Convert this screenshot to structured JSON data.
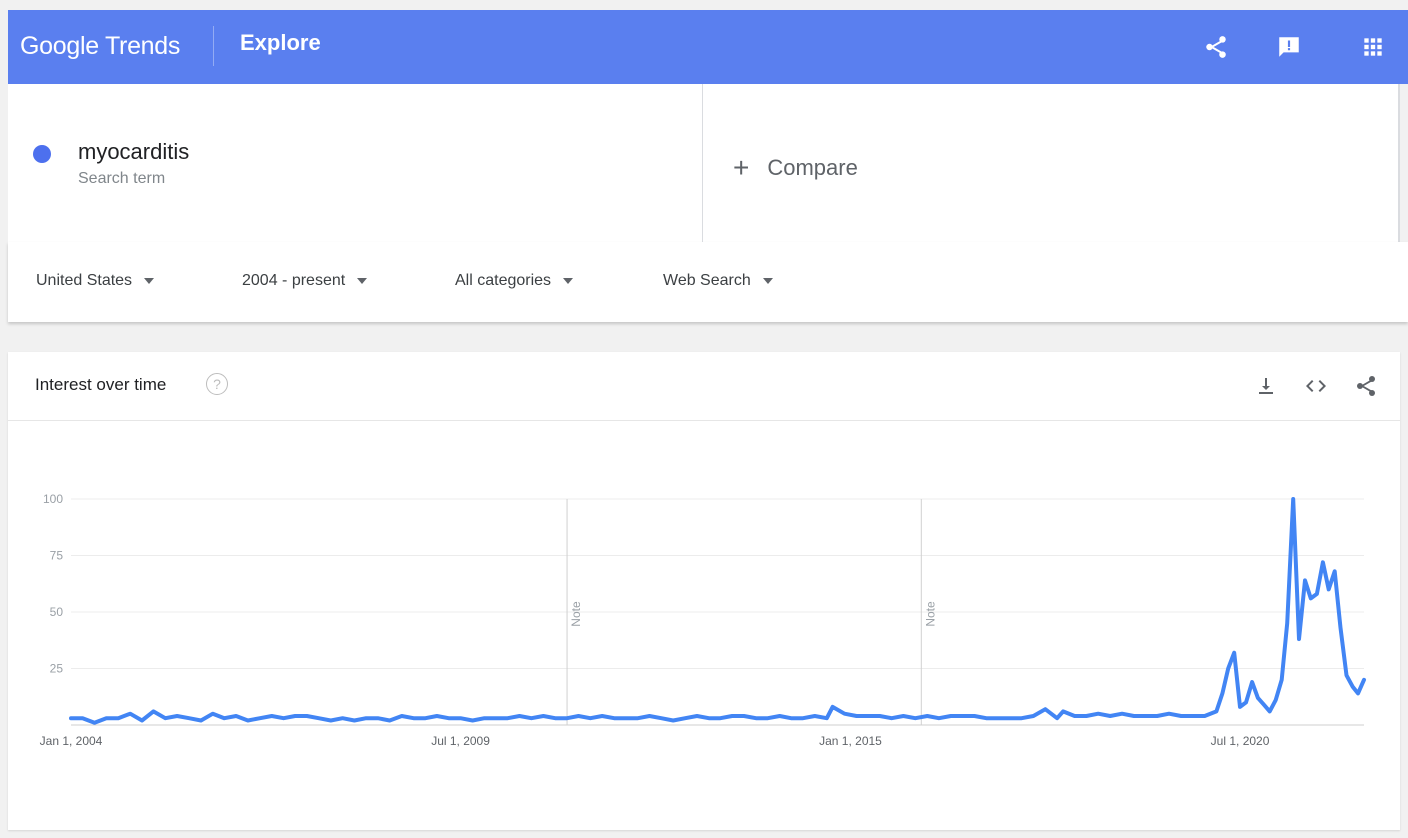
{
  "header": {
    "logo_text": "Google Trends",
    "section": "Explore",
    "icons": [
      "share-icon",
      "feedback-icon",
      "apps-grid-icon"
    ]
  },
  "search": {
    "term": "myocarditis",
    "term_type": "Search term",
    "term_color": "#4d70ee",
    "compare_label": "Compare"
  },
  "filters": {
    "region": "United States",
    "time_range": "2004 - present",
    "category": "All categories",
    "search_type": "Web Search"
  },
  "card": {
    "title": "Interest over time",
    "help_glyph": "?",
    "actions": [
      "download-icon",
      "embed-icon",
      "share-icon"
    ]
  },
  "chart_data": {
    "type": "line",
    "title": "",
    "xlabel": "",
    "ylabel": "",
    "ylim": [
      0,
      100
    ],
    "y_ticks": [
      25,
      50,
      75,
      100
    ],
    "x_ticks": [
      {
        "date": "2004-01-01",
        "label": "Jan 1, 2004"
      },
      {
        "date": "2009-07-01",
        "label": "Jul 1, 2009"
      },
      {
        "date": "2015-01-01",
        "label": "Jan 1, 2015"
      },
      {
        "date": "2020-07-01",
        "label": "Jul 1, 2020"
      }
    ],
    "xlim": [
      "2004-01-01",
      "2022-04-01"
    ],
    "grid": true,
    "line_color": "#4285f4",
    "notes": [
      {
        "date": "2011-01-01",
        "label": "Note"
      },
      {
        "date": "2016-01-01",
        "label": "Note"
      }
    ],
    "series": [
      {
        "name": "myocarditis",
        "points": [
          [
            "2004-01-01",
            3
          ],
          [
            "2004-03-01",
            3
          ],
          [
            "2004-05-01",
            1
          ],
          [
            "2004-07-01",
            3
          ],
          [
            "2004-09-01",
            3
          ],
          [
            "2004-11-01",
            5
          ],
          [
            "2005-01-01",
            2
          ],
          [
            "2005-03-01",
            6
          ],
          [
            "2005-05-01",
            3
          ],
          [
            "2005-07-01",
            4
          ],
          [
            "2005-09-01",
            3
          ],
          [
            "2005-11-01",
            2
          ],
          [
            "2006-01-01",
            5
          ],
          [
            "2006-03-01",
            3
          ],
          [
            "2006-05-01",
            4
          ],
          [
            "2006-07-01",
            2
          ],
          [
            "2006-09-01",
            3
          ],
          [
            "2006-11-01",
            4
          ],
          [
            "2007-01-01",
            3
          ],
          [
            "2007-03-01",
            4
          ],
          [
            "2007-05-01",
            4
          ],
          [
            "2007-07-01",
            3
          ],
          [
            "2007-09-01",
            2
          ],
          [
            "2007-11-01",
            3
          ],
          [
            "2008-01-01",
            2
          ],
          [
            "2008-03-01",
            3
          ],
          [
            "2008-05-01",
            3
          ],
          [
            "2008-07-01",
            2
          ],
          [
            "2008-09-01",
            4
          ],
          [
            "2008-11-01",
            3
          ],
          [
            "2009-01-01",
            3
          ],
          [
            "2009-03-01",
            4
          ],
          [
            "2009-05-01",
            3
          ],
          [
            "2009-07-01",
            3
          ],
          [
            "2009-09-01",
            2
          ],
          [
            "2009-11-01",
            3
          ],
          [
            "2010-01-01",
            3
          ],
          [
            "2010-03-01",
            3
          ],
          [
            "2010-05-01",
            4
          ],
          [
            "2010-07-01",
            3
          ],
          [
            "2010-09-01",
            4
          ],
          [
            "2010-11-01",
            3
          ],
          [
            "2011-01-01",
            3
          ],
          [
            "2011-03-01",
            4
          ],
          [
            "2011-05-01",
            3
          ],
          [
            "2011-07-01",
            4
          ],
          [
            "2011-09-01",
            3
          ],
          [
            "2011-11-01",
            3
          ],
          [
            "2012-01-01",
            3
          ],
          [
            "2012-03-01",
            4
          ],
          [
            "2012-05-01",
            3
          ],
          [
            "2012-07-01",
            2
          ],
          [
            "2012-09-01",
            3
          ],
          [
            "2012-11-01",
            4
          ],
          [
            "2013-01-01",
            3
          ],
          [
            "2013-03-01",
            3
          ],
          [
            "2013-05-01",
            4
          ],
          [
            "2013-07-01",
            4
          ],
          [
            "2013-09-01",
            3
          ],
          [
            "2013-11-01",
            3
          ],
          [
            "2014-01-01",
            4
          ],
          [
            "2014-03-01",
            3
          ],
          [
            "2014-05-01",
            3
          ],
          [
            "2014-07-01",
            4
          ],
          [
            "2014-09-01",
            3
          ],
          [
            "2014-10-01",
            8
          ],
          [
            "2014-12-01",
            5
          ],
          [
            "2015-02-01",
            4
          ],
          [
            "2015-04-01",
            4
          ],
          [
            "2015-06-01",
            4
          ],
          [
            "2015-08-01",
            3
          ],
          [
            "2015-10-01",
            4
          ],
          [
            "2015-12-01",
            3
          ],
          [
            "2016-02-01",
            4
          ],
          [
            "2016-04-01",
            3
          ],
          [
            "2016-06-01",
            4
          ],
          [
            "2016-08-01",
            4
          ],
          [
            "2016-10-01",
            4
          ],
          [
            "2016-12-01",
            3
          ],
          [
            "2017-02-01",
            3
          ],
          [
            "2017-04-01",
            3
          ],
          [
            "2017-06-01",
            3
          ],
          [
            "2017-08-01",
            4
          ],
          [
            "2017-10-01",
            7
          ],
          [
            "2017-12-01",
            3
          ],
          [
            "2018-01-01",
            6
          ],
          [
            "2018-03-01",
            4
          ],
          [
            "2018-05-01",
            4
          ],
          [
            "2018-07-01",
            5
          ],
          [
            "2018-09-01",
            4
          ],
          [
            "2018-11-01",
            5
          ],
          [
            "2019-01-01",
            4
          ],
          [
            "2019-03-01",
            4
          ],
          [
            "2019-05-01",
            4
          ],
          [
            "2019-07-01",
            5
          ],
          [
            "2019-09-01",
            4
          ],
          [
            "2019-11-01",
            4
          ],
          [
            "2020-01-01",
            4
          ],
          [
            "2020-03-01",
            6
          ],
          [
            "2020-04-01",
            14
          ],
          [
            "2020-05-01",
            25
          ],
          [
            "2020-06-01",
            32
          ],
          [
            "2020-07-01",
            8
          ],
          [
            "2020-08-01",
            10
          ],
          [
            "2020-09-01",
            19
          ],
          [
            "2020-10-01",
            12
          ],
          [
            "2020-11-01",
            9
          ],
          [
            "2020-12-01",
            6
          ],
          [
            "2021-01-01",
            11
          ],
          [
            "2021-02-01",
            20
          ],
          [
            "2021-03-01",
            45
          ],
          [
            "2021-04-01",
            100
          ],
          [
            "2021-05-01",
            38
          ],
          [
            "2021-06-01",
            64
          ],
          [
            "2021-07-01",
            56
          ],
          [
            "2021-08-01",
            58
          ],
          [
            "2021-09-01",
            72
          ],
          [
            "2021-10-01",
            60
          ],
          [
            "2021-11-01",
            68
          ],
          [
            "2021-12-01",
            43
          ],
          [
            "2022-01-01",
            22
          ],
          [
            "2022-02-01",
            17
          ],
          [
            "2022-03-01",
            14
          ],
          [
            "2022-04-01",
            20
          ]
        ]
      }
    ]
  }
}
